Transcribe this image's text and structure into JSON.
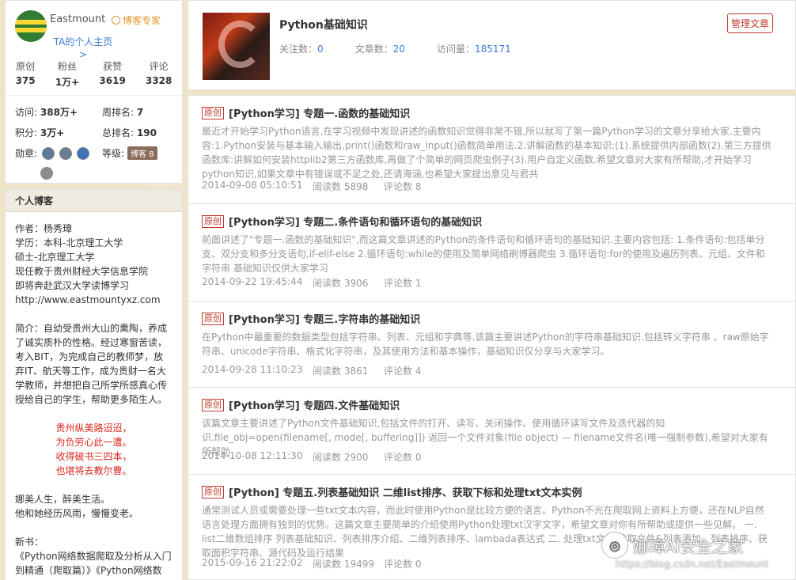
{
  "profile": {
    "username": "Eastmount",
    "expert_label": "博客专家",
    "ta_link": "TA的个人主页 >",
    "stats": [
      {
        "label": "原创",
        "value": "375"
      },
      {
        "label": "粉丝",
        "value": "1万+"
      },
      {
        "label": "获赞",
        "value": "3619"
      },
      {
        "label": "评论",
        "value": "3328"
      }
    ],
    "visits_label": "访问:",
    "visits_value": "388万+",
    "week_rank_label": "周排名:",
    "week_rank_value": "7",
    "points_label": "积分:",
    "points_value": "3万+",
    "total_rank_label": "总排名:",
    "total_rank_value": "190",
    "medals_label": "勋章:",
    "level_label": "等级:",
    "level_tag": "博客 8"
  },
  "blog": {
    "heading": "个人博客",
    "intro": "作者：杨秀璋\n学历：本科-北京理工大学\n      硕士-北京理工大学\n现任教于贵州财经大学信息学院\n即将奔赴武汉大学读博学习\nhttp://www.eastmountyxz.com",
    "bio": "简介：自幼受贵州大山的熏陶，养成了诚实质朴的性格。经过寒窗苦读，考入BIT，为完成自己的教师梦，放弃IT、航天等工作，成为贵财一名大学教师，并想把自己所学所感真心传授给自己的学生，帮助更多陌生人。",
    "poem": "贵州纵美路迢迢，\n为负劳心此一遭。\n收得破书三四本，\n也堪将去教尔曹。",
    "motto": "娜美人生，醉美生活。\n他和她经历风雨，慢慢变老。",
    "books": "新书：\n《Python网络数据爬取及分析从入门到精通（爬取篇）》《Python网络数"
  },
  "header": {
    "title": "Python基础知识",
    "follow_label": "关注数：",
    "follow_value": "0",
    "articles_label": "文章数：",
    "articles_value": "20",
    "views_label": "访问量：",
    "views_value": "185171",
    "manage_label": "管理文章"
  },
  "articles": [
    {
      "tag": "原创",
      "title": "[Python学习] 专题一.函数的基础知识",
      "summary": "最近才开始学习Python语言,在学习视频中发现讲述的函数知识觉得非常不错,所以就写了第一篇Python学习的文章分享给大家.主要内容:1.Python安装与基本输入输出,print()函数和raw_input()函数简单用法.2.讲解函数的基本知识:(1).系统提供内部函数(2).第三方提供函数库:讲解如何安装httplib2第三方函数库,再做了个简单的网页爬虫例子(3).用户自定义函数.希望文章对大家有所帮助,才开始学习python知识,如果文章中有错误或不足之处,还请海涵,也希望大家提出意见与君共",
      "date": "2014-09-08 05:10:51",
      "reads": "阅读数 5898",
      "comments": "评论数 8"
    },
    {
      "tag": "原创",
      "title": "[Python学习] 专题二.条件语句和循环语句的基础知识",
      "summary": "前面讲述了\"专题一.函数的基础知识\",而这篇文章讲述的Python的条件语句和循环语句的基础知识.主要内容包括: 1.条件语句:包括单分支、双分支和多分支语句,if-elif-else 2.循环语句:while的使用及简单网络刷博器爬虫 3.循环语句:for的使用及遍历列表、元组、文件和字符串 基础知识仅供大家学习",
      "date": "2014-09-22 19:45:44",
      "reads": "阅读数 3906",
      "comments": "评论数 1"
    },
    {
      "tag": "原创",
      "title": "[Python学习] 专题三.字符串的基础知识",
      "summary": "在Python中最重要的数据类型包括字符串、列表、元组和字典等.该篇主要讲述Python的字符串基础知识.包括转义字符串 、raw原始字符串、unicode字符串、格式化字符串，及其使用方法和基本操作，基础知识仅分享与大家学习。",
      "date": "2014-09-28 11:10:23",
      "reads": "阅读数 3861",
      "comments": "评论数 4"
    },
    {
      "tag": "原创",
      "title": "[Python学习] 专题四.文件基础知识",
      "summary": "该篇文章主要讲述了Python文件基础知识,包括文件的打开、读写、关闭操作、使用循环读写文件及迭代器的知识.file_obj=open(filename[, mode[, buffering]]) 返回一个文件对象(file object) — filename文件名(唯一强制参数),希望对大家有所帮助",
      "date": "2014-10-08 12:11:30",
      "reads": "阅读数 2900",
      "comments": "评论数 0"
    },
    {
      "tag": "原创",
      "title": "[Python] 专题五.列表基础知识 二维list排序、获取下标和处理txt文本实例",
      "summary": "通常测试人员或需要处理一些txt文本内容，而此时使用Python是比较方便的语言。Python不光在爬取网上资料上方便，还在NLP自然语言处理方面拥有独到的优势。这篇文章主要简单的介绍使用Python处理txt汉字文字，希望文章对你有所帮助或提供一些见解。 一. list二维数组排序 列表基础知识、列表排序介绍、二维列表排序、lambada表达式 二. 处理txt文本 读取文件&列表添加、列表排序、获取面积字符串、源代码及运行结果",
      "date": "2015-09-16 21:22:02",
      "reads": "阅读数 19499",
      "comments": "评论数 0"
    }
  ],
  "watermark": {
    "text": "娜璋AI安全之家",
    "url": "https://blog.csdn.net/Eastmount"
  }
}
